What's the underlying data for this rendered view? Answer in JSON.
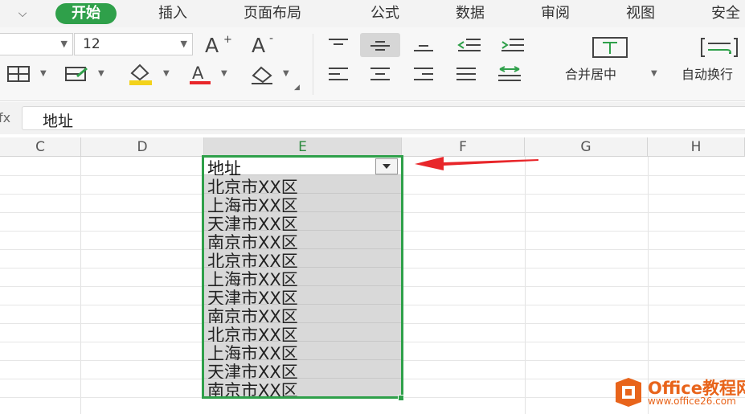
{
  "menu": {
    "tabs": [
      {
        "label": "开始",
        "active": true
      },
      {
        "label": "插入"
      },
      {
        "label": "页面布局"
      },
      {
        "label": "公式"
      },
      {
        "label": "数据"
      },
      {
        "label": "审阅"
      },
      {
        "label": "视图"
      },
      {
        "label": "安全"
      }
    ]
  },
  "ribbon": {
    "font_size": "12",
    "merge_center_label": "合并居中",
    "wrap_text_label": "自动换行"
  },
  "formula_bar": {
    "fx_label": "fx",
    "value": "地址"
  },
  "grid": {
    "columns": [
      "C",
      "D",
      "E",
      "F",
      "G",
      "H"
    ],
    "selected_column": "E",
    "header_cell": "地址",
    "cells": [
      "北京市XX区",
      "上海市XX区",
      "天津市XX区",
      "南京市XX区",
      "北京市XX区",
      "上海市XX区",
      "天津市XX区",
      "南京市XX区",
      "北京市XX区",
      "上海市XX区",
      "天津市XX区",
      "南京市XX区"
    ]
  },
  "colors": {
    "accent_green": "#2fa04a",
    "arrow_red": "#e8262a",
    "watermark_orange": "#e8641b"
  },
  "watermark": {
    "brand": "Office教程网",
    "url": "www.office26.com"
  }
}
